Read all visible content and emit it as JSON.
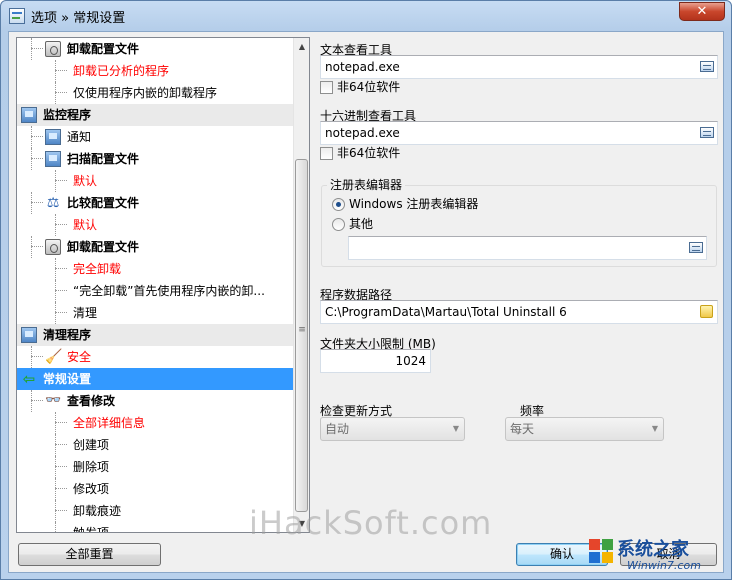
{
  "window": {
    "title": "选项 » 常规设置",
    "close_label": "✕"
  },
  "tree": {
    "items": [
      {
        "label": "卸载配置文件",
        "level": 1,
        "icon": "recycle-bin-icon",
        "bold": true,
        "red": false,
        "header": false
      },
      {
        "label": "卸载已分析的程序",
        "level": 2,
        "icon": "",
        "bold": false,
        "red": true,
        "header": false
      },
      {
        "label": "仅使用程序内嵌的卸载程序",
        "level": 2,
        "icon": "",
        "bold": false,
        "red": false,
        "header": false
      },
      {
        "label": "监控程序",
        "level": 0,
        "icon": "monitor-program-icon",
        "bold": true,
        "red": false,
        "header": true
      },
      {
        "label": "通知",
        "level": 1,
        "icon": "monitor-icon",
        "bold": false,
        "red": false,
        "header": false
      },
      {
        "label": "扫描配置文件",
        "level": 1,
        "icon": "scan-monitor-icon",
        "bold": true,
        "red": false,
        "header": false
      },
      {
        "label": "默认",
        "level": 2,
        "icon": "",
        "bold": false,
        "red": true,
        "header": false
      },
      {
        "label": "比较配置文件",
        "level": 1,
        "icon": "scale-icon",
        "bold": true,
        "red": false,
        "header": false
      },
      {
        "label": "默认",
        "level": 2,
        "icon": "",
        "bold": false,
        "red": true,
        "header": false
      },
      {
        "label": "卸载配置文件",
        "level": 1,
        "icon": "recycle-bin-icon",
        "bold": true,
        "red": false,
        "header": false
      },
      {
        "label": "完全卸载",
        "level": 2,
        "icon": "",
        "bold": false,
        "red": true,
        "header": false
      },
      {
        "label": "“完全卸载”首先使用程序内嵌的卸...",
        "level": 2,
        "icon": "",
        "bold": false,
        "red": false,
        "header": false
      },
      {
        "label": "清理",
        "level": 2,
        "icon": "",
        "bold": false,
        "red": false,
        "header": false
      },
      {
        "label": "清理程序",
        "level": 0,
        "icon": "cleaner-program-icon",
        "bold": true,
        "red": false,
        "header": true
      },
      {
        "label": "安全",
        "level": 1,
        "icon": "broom-icon",
        "bold": false,
        "red": true,
        "header": false
      },
      {
        "label": "常规设置",
        "level": 0,
        "icon": "green-arrow-icon",
        "bold": true,
        "red": false,
        "header": false,
        "selected": true
      },
      {
        "label": "查看修改",
        "level": 1,
        "icon": "glasses-icon",
        "bold": true,
        "red": false,
        "header": false
      },
      {
        "label": "全部详细信息",
        "level": 2,
        "icon": "",
        "bold": false,
        "red": true,
        "header": false
      },
      {
        "label": "创建项",
        "level": 2,
        "icon": "",
        "bold": false,
        "red": false,
        "header": false
      },
      {
        "label": "删除项",
        "level": 2,
        "icon": "",
        "bold": false,
        "red": false,
        "header": false
      },
      {
        "label": "修改项",
        "level": 2,
        "icon": "",
        "bold": false,
        "red": false,
        "header": false
      },
      {
        "label": "卸载痕迹",
        "level": 2,
        "icon": "",
        "bold": false,
        "red": false,
        "header": false
      },
      {
        "label": "触发项",
        "level": 2,
        "icon": "",
        "bold": false,
        "red": false,
        "header": false
      }
    ]
  },
  "settings": {
    "text_viewer": {
      "label": "文本查看工具",
      "value": "notepad.exe",
      "checkbox_label": "非64位软件"
    },
    "hex_viewer": {
      "label": "十六进制查看工具",
      "value": "notepad.exe",
      "checkbox_label": "非64位软件"
    },
    "registry": {
      "group_label": "注册表编辑器",
      "option_windows": "Windows 注册表编辑器",
      "option_other": "其他",
      "other_value": ""
    },
    "data_path": {
      "label": "程序数据路径",
      "value": "C:\\ProgramData\\Martau\\Total Uninstall 6"
    },
    "folder_limit": {
      "label": "文件夹大小限制 (MB)",
      "value": "1024"
    },
    "update_method": {
      "label": "检查更新方式",
      "value": "自动"
    },
    "frequency": {
      "label": "频率",
      "value": "每天"
    }
  },
  "buttons": {
    "reset_all": "全部重置",
    "ok": "确认",
    "cancel": "取消"
  },
  "watermarks": {
    "main": "iHackSoft.com",
    "brand": "系统之家",
    "url": "Winwin7.com"
  }
}
